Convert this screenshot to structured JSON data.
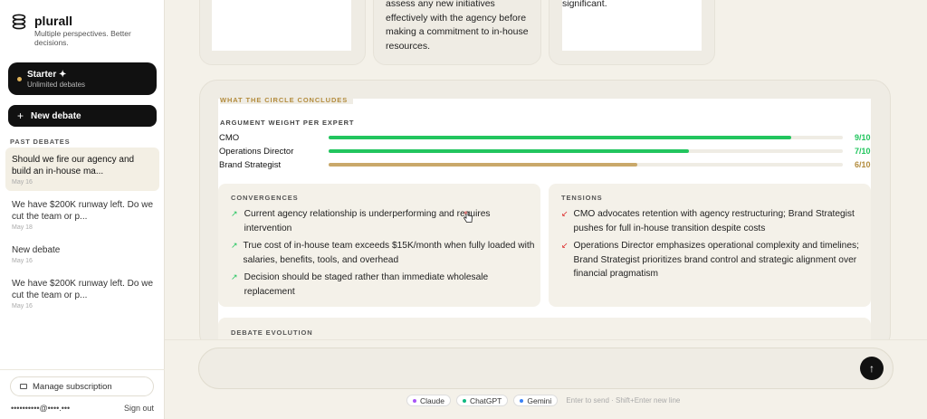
{
  "brand": {
    "name": "plurall",
    "tagline": "Multiple perspectives. Better decisions."
  },
  "plan": {
    "name": "Starter ✦",
    "subtitle": "Unlimited debates"
  },
  "new_debate_label": "New debate",
  "past_debates_label": "PAST DEBATES",
  "history": [
    {
      "title": "Should we fire our agency and build an in-house ma...",
      "date": "May 16",
      "active": true
    },
    {
      "title": "We have $200K runway left. Do we cut the team or p...",
      "date": "May 18",
      "active": false
    },
    {
      "title": "New debate",
      "date": "May 16",
      "active": false
    },
    {
      "title": "We have $200K runway left. Do we cut the team or p...",
      "date": "May 16",
      "active": false
    }
  ],
  "manage_subscription_label": "Manage subscription",
  "user_email": "••••••••••@••••.•••",
  "sign_out_label": "Sign out",
  "top_cards": {
    "middle_text": "assess any new initiatives effectively with the agency before making a commitment to in-house resources.",
    "right_text": "significant."
  },
  "conclusions": {
    "label": "WHAT THE CIRCLE CONCLUDES",
    "weight_label": "ARGUMENT WEIGHT PER EXPERT",
    "experts": [
      {
        "name": "CMO",
        "score": "9/10",
        "fraction": 0.9,
        "color": "#22c55e"
      },
      {
        "name": "Operations Director",
        "score": "7/10",
        "fraction": 0.7,
        "color": "#22c55e"
      },
      {
        "name": "Brand Strategist",
        "score": "6/10",
        "fraction": 0.6,
        "color": "#c9a86a"
      }
    ],
    "convergences_label": "CONVERGENCES",
    "convergences": [
      "Current agency relationship is underperforming and requires intervention",
      "True cost of in-house team exceeds $15K/month when fully loaded with salaries, benefits, tools, and overhead",
      "Decision should be staged rather than immediate wholesale replacement"
    ],
    "tensions_label": "TENSIONS",
    "tensions": [
      "CMO advocates retention with agency restructuring; Brand Strategist pushes for full in-house transition despite costs",
      "Operations Director emphasizes operational complexity and timelines; Brand Strategist prioritizes brand control and strategic alignment over financial pragmatism"
    ],
    "evolution_label": "DEBATE EVOLUTION"
  },
  "composer": {
    "placeholder": "",
    "models": [
      {
        "name": "Claude",
        "color": "#a855f7"
      },
      {
        "name": "ChatGPT",
        "color": "#10b981"
      },
      {
        "name": "Gemini",
        "color": "#3b82f6"
      }
    ],
    "hint": "Enter to send · Shift+Enter new line"
  },
  "colors": {
    "accent_gold": "#b38c3e",
    "success": "#22c55e",
    "danger": "#dc2626"
  }
}
